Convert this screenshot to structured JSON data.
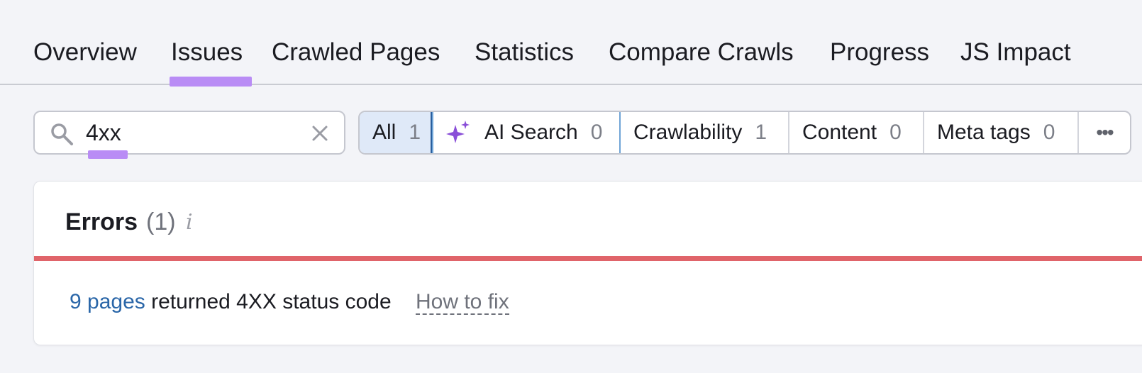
{
  "tabs": [
    {
      "label": "Overview"
    },
    {
      "label": "Issues",
      "active": true
    },
    {
      "label": "Crawled Pages"
    },
    {
      "label": "Statistics"
    },
    {
      "label": "Compare Crawls"
    },
    {
      "label": "Progress"
    },
    {
      "label": "JS Impact"
    }
  ],
  "search": {
    "value": "4xx",
    "icon": "search-icon",
    "clear_icon": "close-icon"
  },
  "filters": [
    {
      "label": "All",
      "count": "1",
      "selected": true
    },
    {
      "label": "AI Search",
      "count": "0",
      "icon": "sparkle-icon"
    },
    {
      "label": "Crawlability",
      "count": "1"
    },
    {
      "label": "Content",
      "count": "0"
    },
    {
      "label": "Meta tags",
      "count": "0"
    },
    {
      "label": "•••",
      "icon": "more-icon"
    }
  ],
  "errors_card": {
    "title": "Errors",
    "count": "(1)",
    "info_icon": "i",
    "issue": {
      "link": "9 pages",
      "text": "returned 4XX status code",
      "action": "How to fix"
    }
  },
  "colors": {
    "accent_underline": "#b98cf5",
    "error_bar": "#e0646a",
    "link": "#2a66a8",
    "selected_filter_bg": "#dfe9f8"
  }
}
